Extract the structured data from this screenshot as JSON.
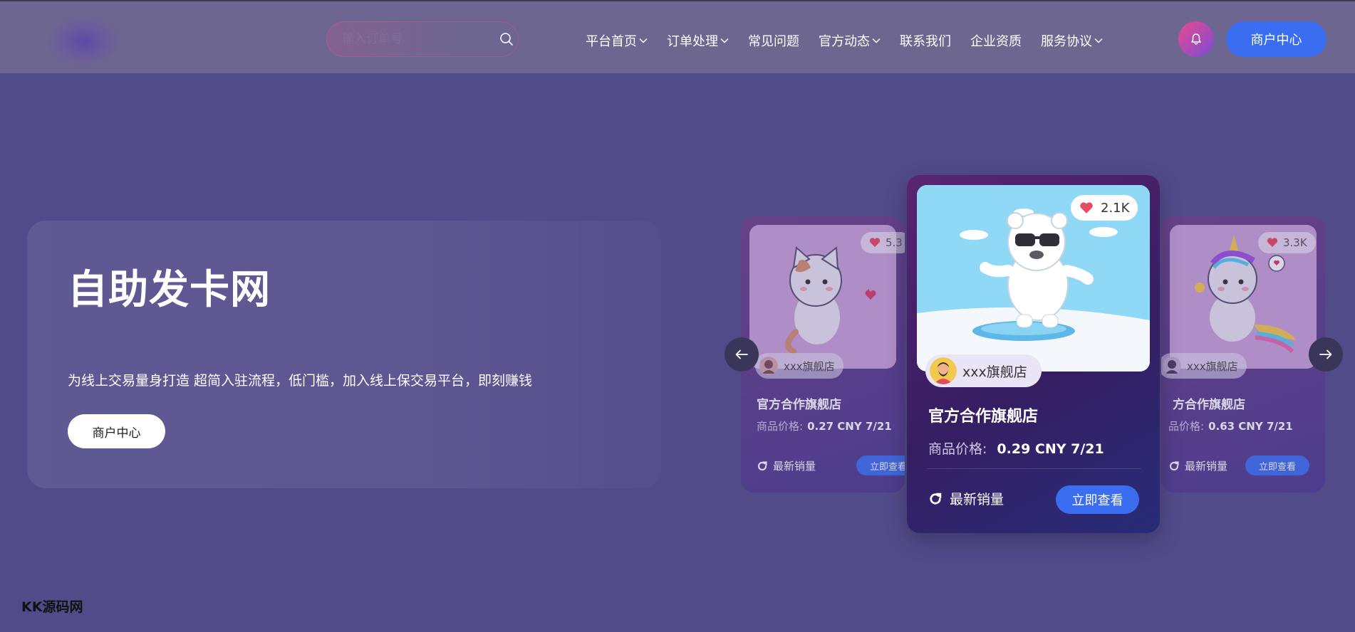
{
  "header": {
    "search_placeholder": "输入订单号",
    "nav": [
      {
        "label": "平台首页",
        "has_dropdown": true
      },
      {
        "label": "订单处理",
        "has_dropdown": true
      },
      {
        "label": "常见问题",
        "has_dropdown": false
      },
      {
        "label": "官方动态",
        "has_dropdown": true
      },
      {
        "label": "联系我们",
        "has_dropdown": false
      },
      {
        "label": "企业资质",
        "has_dropdown": false
      },
      {
        "label": "服务协议",
        "has_dropdown": true
      }
    ],
    "merchant_button": "商户中心"
  },
  "hero": {
    "title": "自助发卡网",
    "subtitle": "为线上交易量身打造 超简入驻流程，低门槛，加入线上保交易平台，即刻赚钱",
    "button": "商户中心"
  },
  "cards": {
    "left": {
      "likes": "5.3",
      "store": "xxx旗舰店",
      "title": "官方合作旗舰店",
      "price_label": "商品价格:",
      "price": "0.27 CNY 7/21",
      "sales": "最新销量",
      "button": "立即查看"
    },
    "center": {
      "likes": "2.1K",
      "store": "xxx旗舰店",
      "title": "官方合作旗舰店",
      "price_label": "商品价格:",
      "price": "0.29 CNY 7/21",
      "sales": "最新销量",
      "button": "立即查看"
    },
    "right": {
      "likes": "3.3K",
      "store": "xxx旗舰店",
      "title": "方合作旗舰店",
      "price_label": "品价格:",
      "price": "0.63 CNY 7/21",
      "sales": "最新销量",
      "button": "立即查看"
    }
  },
  "watermark": "KK源码网",
  "colors": {
    "background": "#524b8a",
    "header": "#6d6691",
    "accent_blue": "#3a6df0",
    "like_heart": "#e84a5f"
  }
}
